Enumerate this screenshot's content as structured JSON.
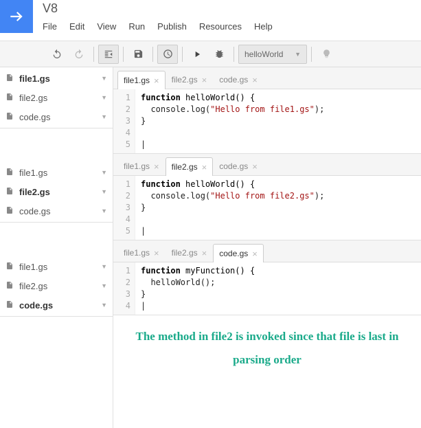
{
  "header": {
    "title": "V8",
    "menu": [
      "File",
      "Edit",
      "View",
      "Run",
      "Publish",
      "Resources",
      "Help"
    ]
  },
  "toolbar": {
    "function_select": "helloWorld"
  },
  "sidebar_groups": [
    {
      "files": [
        "file1.gs",
        "file2.gs",
        "code.gs"
      ],
      "active_index": 0
    },
    {
      "files": [
        "file1.gs",
        "file2.gs",
        "code.gs"
      ],
      "active_index": 1
    },
    {
      "files": [
        "file1.gs",
        "file2.gs",
        "code.gs"
      ],
      "active_index": 2
    }
  ],
  "editors": [
    {
      "tabs": [
        "file1.gs",
        "file2.gs",
        "code.gs"
      ],
      "active_tab": 0,
      "line_count": 5,
      "code_lines": [
        {
          "t": "fn_decl",
          "name": "helloWorld"
        },
        {
          "t": "log",
          "str": "\"Hello from file1.gs\""
        },
        {
          "t": "close"
        },
        {
          "t": "blank"
        },
        {
          "t": "cursor"
        }
      ]
    },
    {
      "tabs": [
        "file1.gs",
        "file2.gs",
        "code.gs"
      ],
      "active_tab": 1,
      "line_count": 5,
      "code_lines": [
        {
          "t": "fn_decl",
          "name": "helloWorld"
        },
        {
          "t": "log",
          "str": "\"Hello from file2.gs\""
        },
        {
          "t": "close"
        },
        {
          "t": "blank"
        },
        {
          "t": "cursor"
        }
      ]
    },
    {
      "tabs": [
        "file1.gs",
        "file2.gs",
        "code.gs"
      ],
      "active_tab": 2,
      "line_count": 4,
      "code_lines": [
        {
          "t": "fn_decl",
          "name": "myFunction"
        },
        {
          "t": "call",
          "name": "helloWorld"
        },
        {
          "t": "close"
        },
        {
          "t": "cursor"
        }
      ]
    }
  ],
  "annotation": "The method in file2 is invoked since that file is last in parsing order"
}
